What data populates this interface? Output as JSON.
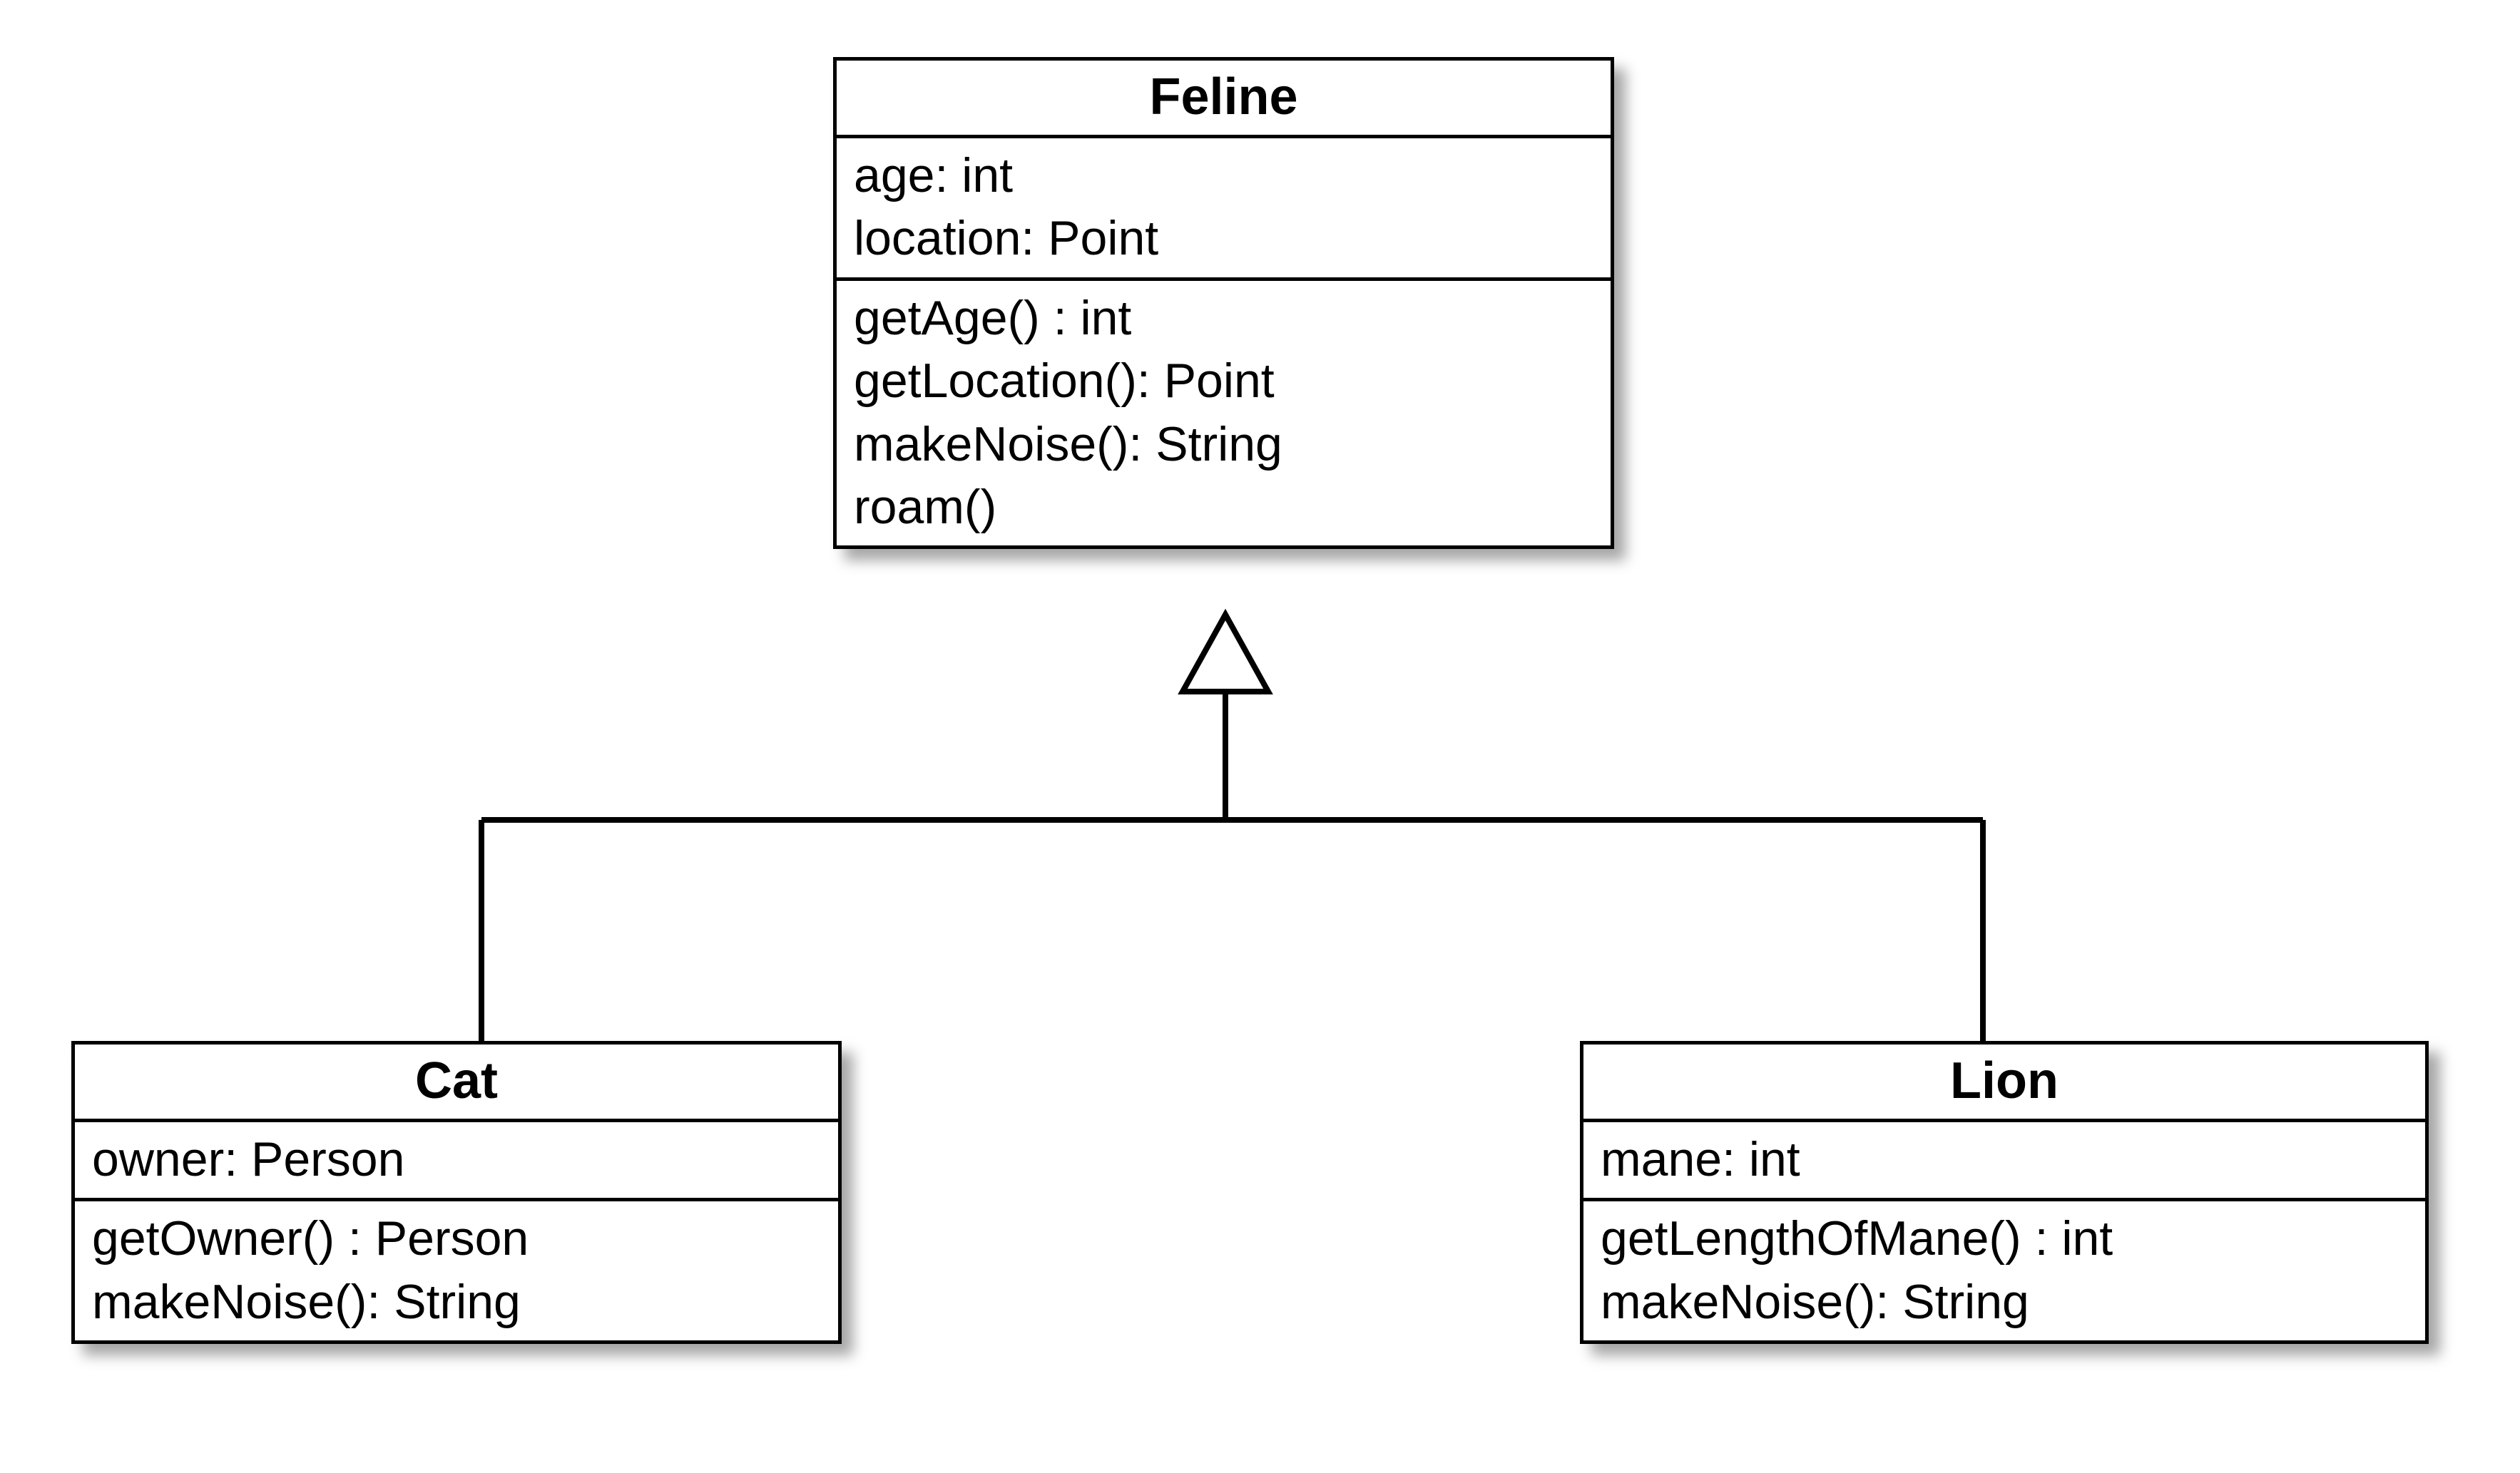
{
  "diagram": {
    "type": "uml-class",
    "parent": {
      "name": "Feline",
      "attributes": [
        "age: int",
        "location: Point"
      ],
      "operations": [
        "getAge() : int",
        "getLocation(): Point",
        "makeNoise(): String",
        "roam()"
      ]
    },
    "children": [
      {
        "name": "Cat",
        "attributes": [
          "owner: Person"
        ],
        "operations": [
          "getOwner() : Person",
          "makeNoise(): String"
        ]
      },
      {
        "name": "Lion",
        "attributes": [
          "mane: int"
        ],
        "operations": [
          "getLengthOfMane() : int",
          "makeNoise(): String"
        ]
      }
    ],
    "relation": "generalization"
  }
}
